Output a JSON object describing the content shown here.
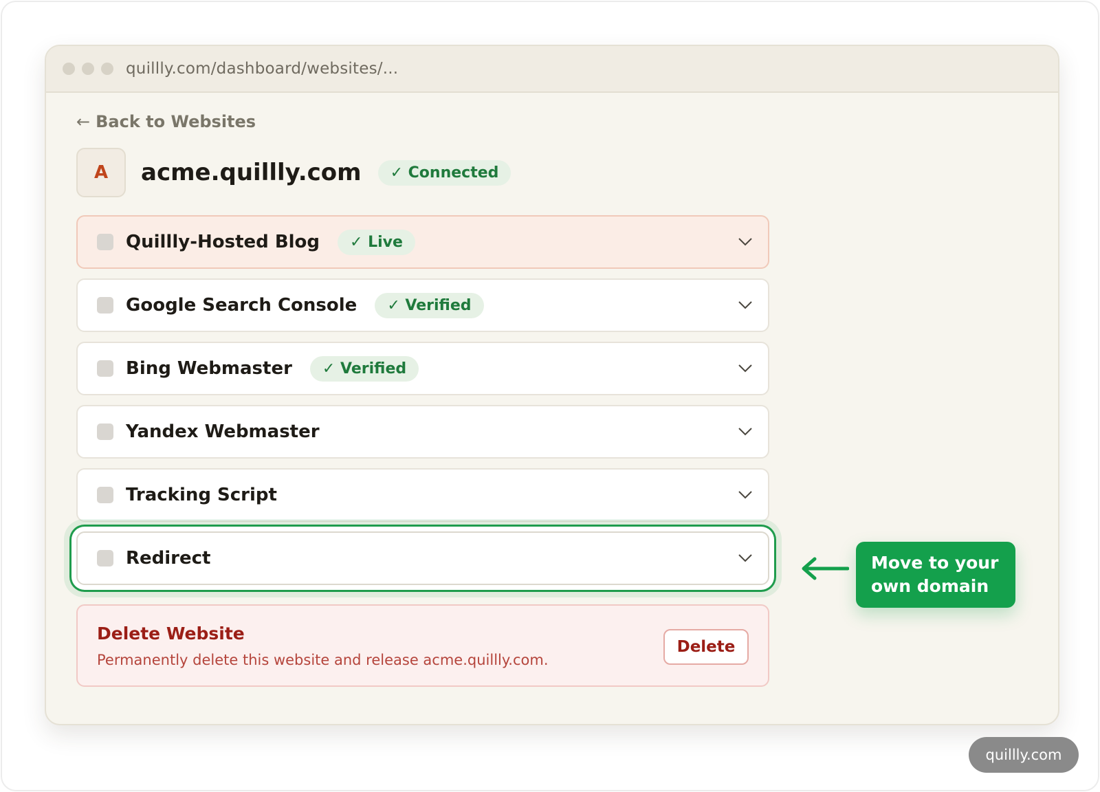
{
  "browser": {
    "url": "quillly.com/dashboard/websites/..."
  },
  "nav": {
    "back_arrow": "←",
    "back_label": "Back to Websites"
  },
  "site": {
    "avatar_letter": "A",
    "domain": "acme.quillly.com",
    "status": "✓ Connected"
  },
  "sections": [
    {
      "label": "Quillly-Hosted Blog",
      "badge": "✓ Live"
    },
    {
      "label": "Google Search Console",
      "badge": "✓ Verified"
    },
    {
      "label": "Bing Webmaster",
      "badge": "✓ Verified"
    },
    {
      "label": "Yandex Webmaster"
    },
    {
      "label": "Tracking Script"
    },
    {
      "label": "Redirect"
    }
  ],
  "danger_zone": {
    "title": "Delete Website",
    "description": "Permanently delete this website and release acme.quillly.com.",
    "button_label": "Delete"
  },
  "callout": {
    "line1": "Move to your",
    "line2": "own domain"
  },
  "watermark": "quillly.com",
  "colors": {
    "accent_green": "#14a04c",
    "danger_red": "#9b1e16",
    "badge_green_bg": "#e6f1e5",
    "page_bg": "#f7f5ee"
  },
  "icons": {
    "section_toggle": "chevron-down-icon",
    "callout_pointer": "arrow-left-icon"
  }
}
